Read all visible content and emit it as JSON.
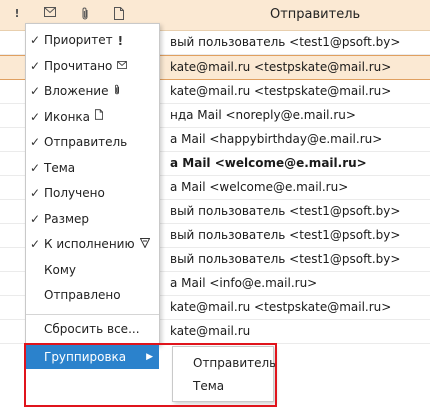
{
  "header": {
    "title": "Отправитель",
    "icons": [
      "priority-icon",
      "envelope-icon",
      "paperclip-icon",
      "document-icon"
    ],
    "priority_glyph": "!"
  },
  "messages": [
    {
      "sender": "вый пользователь <test1@psoft.by>",
      "bold": false,
      "selected": false
    },
    {
      "sender": "kate@mail.ru <testpskate@mail.ru>",
      "bold": false,
      "selected": true
    },
    {
      "sender": "kate@mail.ru <testpskate@mail.ru>",
      "bold": false,
      "selected": false
    },
    {
      "sender": "нда Mail <noreply@e.mail.ru>",
      "bold": false,
      "selected": false
    },
    {
      "sender": "а Mail <happybirthday@e.mail.ru>",
      "bold": false,
      "selected": false
    },
    {
      "sender": "а Mail <welcome@e.mail.ru>",
      "bold": true,
      "selected": false
    },
    {
      "sender": "а Mail <welcome@e.mail.ru>",
      "bold": false,
      "selected": false
    },
    {
      "sender": "вый пользователь <test1@psoft.by>",
      "bold": false,
      "selected": false
    },
    {
      "sender": "вый пользователь <test1@psoft.by>",
      "bold": false,
      "selected": false
    },
    {
      "sender": "вый пользователь <test1@psoft.by>",
      "bold": false,
      "selected": false
    },
    {
      "sender": "а Mail <info@e.mail.ru>",
      "bold": false,
      "selected": false
    },
    {
      "sender": "kate@mail.ru <testpskate@mail.ru>",
      "bold": false,
      "selected": false
    },
    {
      "sender": "kate@mail.ru",
      "bold": false,
      "selected": false
    }
  ],
  "menu": {
    "items": [
      {
        "label": "Приоритет",
        "checked": true,
        "icon": "priority-icon",
        "glyph": "!"
      },
      {
        "label": "Прочитано",
        "checked": true,
        "icon": "envelope-icon"
      },
      {
        "label": "Вложение",
        "checked": true,
        "icon": "paperclip-icon"
      },
      {
        "label": "Иконка",
        "checked": true,
        "icon": "document-icon"
      },
      {
        "label": "Отправитель",
        "checked": true
      },
      {
        "label": "Тема",
        "checked": true
      },
      {
        "label": "Получено",
        "checked": true
      },
      {
        "label": "Размер",
        "checked": true
      },
      {
        "label": "К исполнению",
        "checked": true,
        "icon": "flag-icon"
      },
      {
        "label": "Кому",
        "checked": false
      },
      {
        "label": "Отправлено",
        "checked": false
      }
    ],
    "checkmark": "✓",
    "reset": "Сбросить все...",
    "grouping": "Группировка",
    "grouping_arrow": "▶"
  },
  "submenu": {
    "items": [
      "Отправитель",
      "Тема"
    ]
  },
  "colors": {
    "header_bg": "#fbe9d3",
    "selected_bg": "#fbe9d3",
    "active_item": "#2b82cc",
    "highlight_border": "#e0141c"
  }
}
